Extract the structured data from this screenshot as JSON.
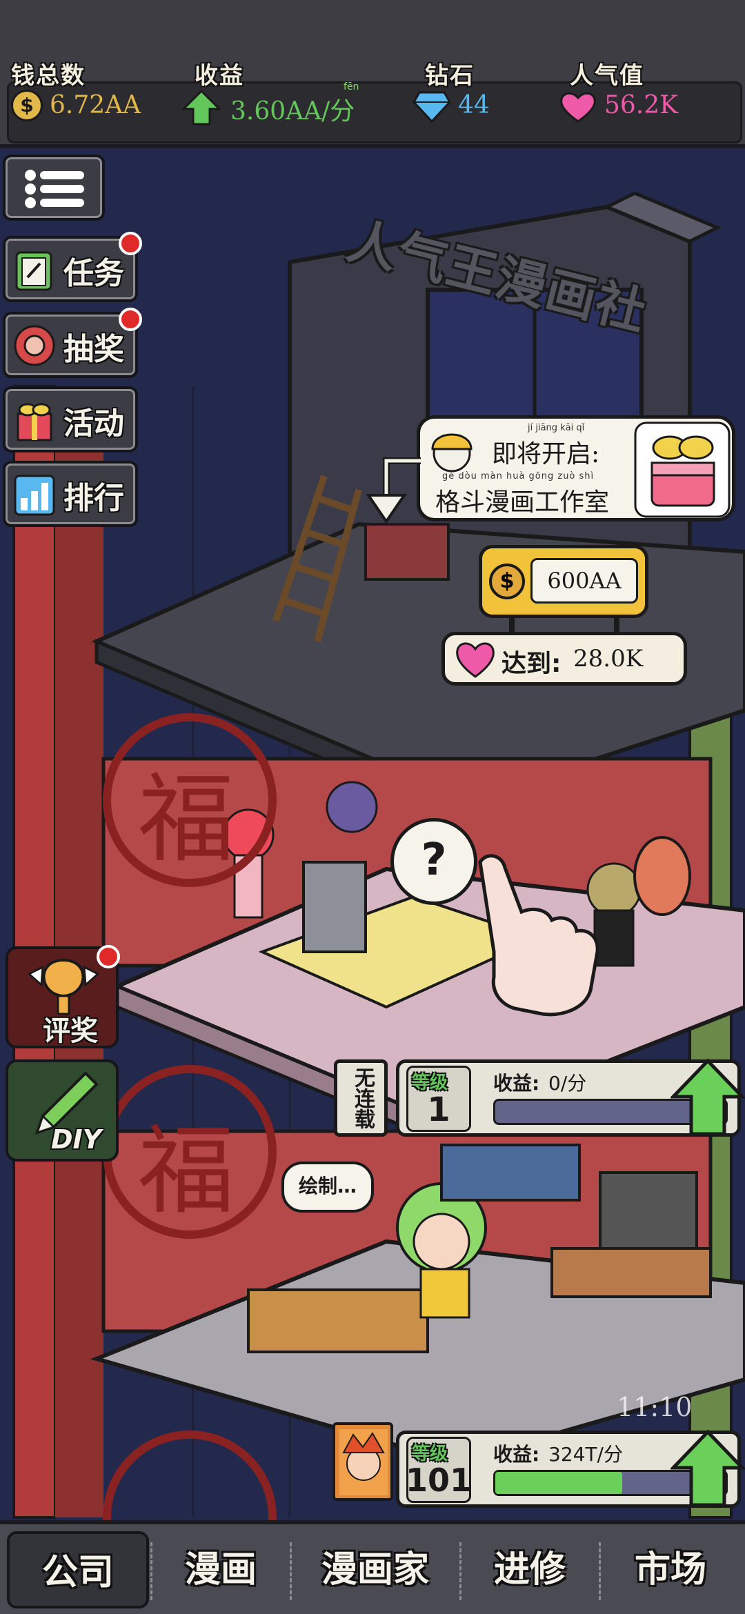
{
  "top_stats": {
    "money": {
      "label": "钱总数",
      "value": "6.72AA",
      "icon": "coin-icon",
      "color": "#e2b84a"
    },
    "income": {
      "label": "收益",
      "value": "3.60AA/分",
      "pinyin": "fēn",
      "icon": "arrow-up-icon",
      "color": "#63c65a"
    },
    "diamonds": {
      "label": "钻石",
      "value": "44",
      "icon": "diamond-icon",
      "color": "#5ab8f0"
    },
    "popularity": {
      "label": "人气值",
      "value": "56.2K",
      "icon": "heart-icon",
      "color": "#ee5aa8"
    }
  },
  "side_menu": [
    {
      "label": "",
      "icon": "menu-list-icon"
    },
    {
      "label": "任务",
      "icon": "task-clipboard-icon",
      "badge": true
    },
    {
      "label": "抽奖",
      "icon": "lottery-icon",
      "badge": true
    },
    {
      "label": "活动",
      "icon": "gift-icon",
      "badge": false
    },
    {
      "label": "排行",
      "icon": "ranking-icon",
      "badge": false
    }
  ],
  "side_extra": {
    "award_label": "评奖",
    "diy_label": "DIY"
  },
  "building": {
    "sign": "人气王漫画社",
    "fu_char": "福"
  },
  "upcoming": {
    "title": "即将开启:",
    "title_pinyin": "jí  jiāng  kāi  qǐ",
    "name": "格斗漫画工作室",
    "name_pinyin": "gé  dòu  màn  huà  gōng  zuò  shì",
    "cost": "600AA",
    "require_label": "达到:",
    "require_value": "28.0K"
  },
  "floors": [
    {
      "status": "无连载",
      "level_label": "等级",
      "level": "1",
      "income_label": "收益:",
      "income": "0/分",
      "progress": 0
    },
    {
      "speech": "绘制…",
      "level_label": "等级",
      "level": "101",
      "income_label": "收益:",
      "income": "324T/分",
      "progress": 0.55
    }
  ],
  "clock": "11:10",
  "bottom_nav": {
    "tabs": [
      "公司",
      "漫画",
      "漫画家",
      "进修",
      "市场"
    ],
    "active": "公司"
  }
}
